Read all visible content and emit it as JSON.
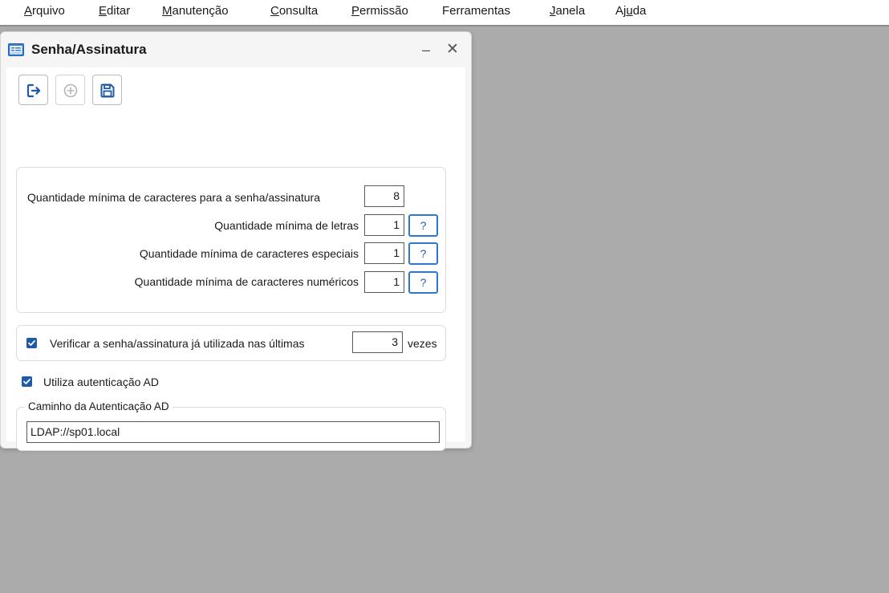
{
  "menu": {
    "items": [
      {
        "pre": "",
        "u": "A",
        "post": "rquivo"
      },
      {
        "pre": "",
        "u": "E",
        "post": "ditar"
      },
      {
        "pre": "",
        "u": "M",
        "post": "anutenção"
      },
      {
        "pre": "",
        "u": "C",
        "post": "onsulta"
      },
      {
        "pre": "",
        "u": "P",
        "post": "ermissão"
      },
      {
        "pre": "Ferramentas",
        "u": "",
        "post": ""
      },
      {
        "pre": "",
        "u": "J",
        "post": "anela"
      },
      {
        "pre": "Aj",
        "u": "u",
        "post": "da"
      }
    ]
  },
  "window": {
    "title": "Senha/Assinatura",
    "minimize": "–",
    "close": "✕"
  },
  "toolbar": {
    "exit_icon": "exit-icon",
    "add_icon": "add-circle-icon",
    "save_icon": "save-disk-icon"
  },
  "password_rules": {
    "min_chars_label": "Quantidade mínima de caracteres para a senha/assinatura",
    "min_chars_value": "8",
    "min_letters_label": "Quantidade mínima de letras",
    "min_letters_value": "1",
    "min_special_label": "Quantidade mínima de caracteres especiais",
    "min_special_value": "1",
    "min_numeric_label": "Quantidade mínima de caracteres numéricos",
    "min_numeric_value": "1",
    "help_label": "?"
  },
  "history": {
    "checked": true,
    "label": "Verificar a senha/assinatura já utilizada nas últimas",
    "value": "3",
    "suffix": "vezes"
  },
  "ad": {
    "checked": true,
    "label": "Utiliza autenticação AD",
    "group_title": "Caminho da Autenticação AD",
    "path_value": "LDAP://sp01.local"
  },
  "colors": {
    "accent": "#1e5aa8",
    "help_border": "#2f78d0",
    "background": "#ababab"
  }
}
